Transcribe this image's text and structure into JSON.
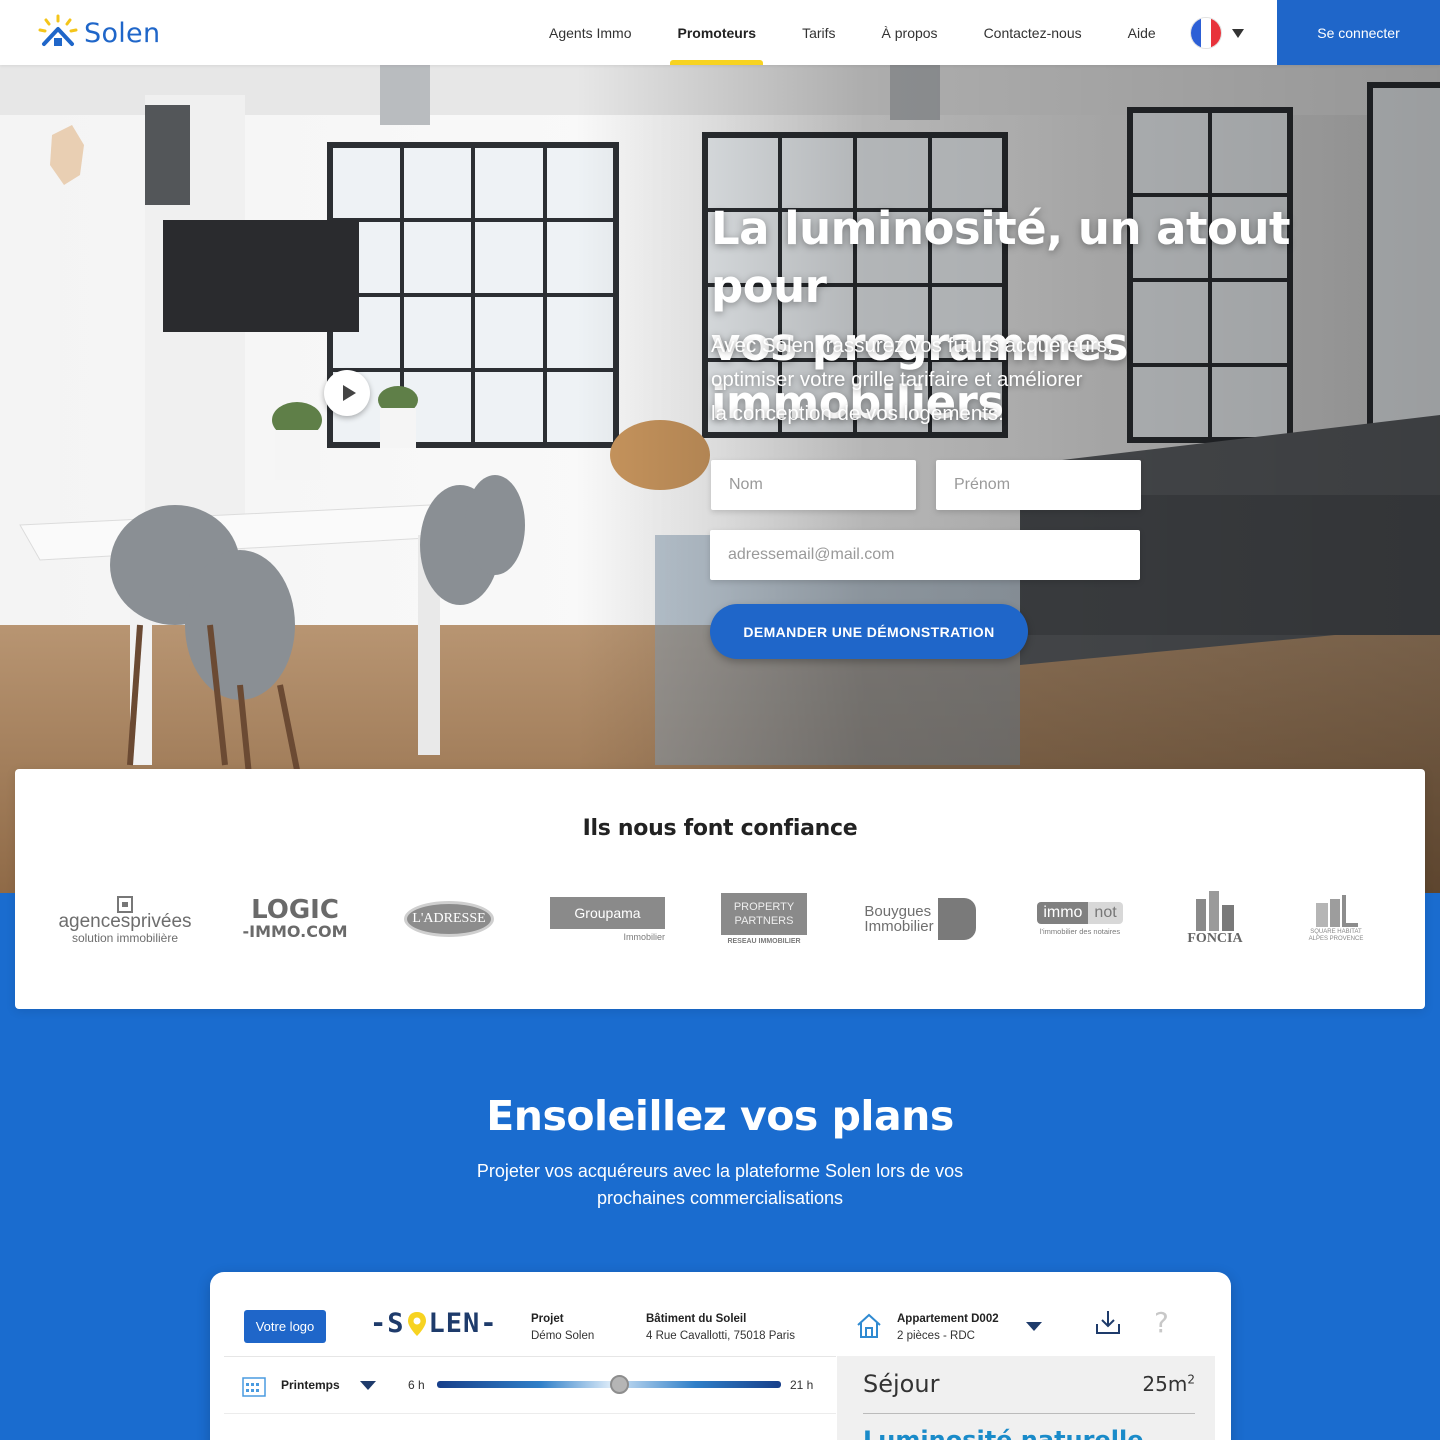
{
  "nav": {
    "brand": "Solen",
    "links": [
      {
        "label": "Agents Immo",
        "active": false
      },
      {
        "label": "Promoteurs",
        "active": true
      },
      {
        "label": "Tarifs",
        "active": false
      },
      {
        "label": "À propos",
        "active": false
      },
      {
        "label": "Contactez-nous",
        "active": false
      },
      {
        "label": "Aide",
        "active": false
      }
    ],
    "language_icon": "france-flag-icon",
    "login_label": "Se connecter"
  },
  "hero": {
    "title_line1": "La luminosité, un atout pour",
    "title_line2": "vos programmes immobiliers",
    "subtitle_line1": "Avec Solen, rassurez vos futurs acquéreurs,",
    "subtitle_line2": "optimiser votre grille tarifaire et améliorer",
    "subtitle_line3": "la conception de vos logements.",
    "form": {
      "nom_placeholder": "Nom",
      "prenom_placeholder": "Prénom",
      "email_placeholder": "adressemail@mail.com",
      "submit_label": "DEMANDER UNE DÉMONSTRATION"
    }
  },
  "trust": {
    "title": "Ils nous font confiance",
    "partners": [
      {
        "line1": "agencesprivées",
        "line2": "solution immobilière"
      },
      {
        "line1": "LOGIC",
        "line2": "-IMMO.COM"
      },
      {
        "line1": "L'ADRESSE"
      },
      {
        "line1": "Groupama",
        "line2": "Immobilier"
      },
      {
        "line1": "PROPERTY",
        "line2": "PARTNERS",
        "line3": "RESEAU IMMOBILIER"
      },
      {
        "line1": "Bouygues",
        "line2": "Immobilier"
      },
      {
        "line1": "immo",
        "line2": "not",
        "line3": "l'immobilier des notaires"
      },
      {
        "line1": "FONCIA"
      },
      {
        "line1": "SQUARE HABITAT",
        "line2": "ALPES PROVENCE"
      }
    ]
  },
  "section2": {
    "title": "Ensoleillez vos plans",
    "subtitle_line1": "Projeter vos acquéreurs avec la plateforme Solen lors de vos",
    "subtitle_line2": "prochaines commercialisations"
  },
  "app": {
    "logo_button": "Votre logo",
    "brand_left": "-S",
    "brand_right": "LEN-",
    "project_label": "Projet",
    "project_value": "Démo Solen",
    "building_label": "Bâtiment du Soleil",
    "building_value": "4 Rue Cavallotti, 75018 Paris",
    "apartment_label": "Appartement D002",
    "apartment_value": "2 pièces - RDC",
    "season": "Printemps",
    "hour_min": "6 h",
    "hour_max": "21 h",
    "slider_value": 0.53,
    "help_glyph": "?",
    "room_name": "Séjour",
    "room_size": "25m",
    "room_size_unit": "2",
    "room_sub": "Luminosité naturelle"
  },
  "colors": {
    "brand_blue": "#1f66c9",
    "accent_yellow": "#f7d321",
    "section_blue": "#1a6ccf"
  }
}
